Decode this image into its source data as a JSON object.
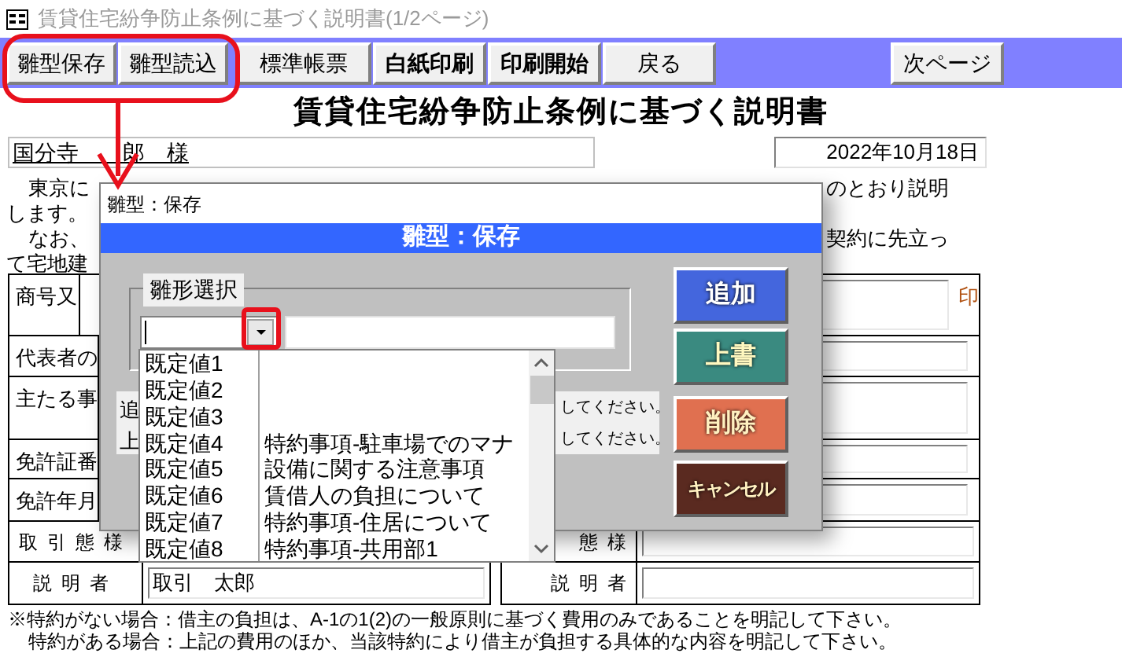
{
  "window": {
    "title": "賃貸住宅紛争防止条例に基づく説明書(1/2ページ)"
  },
  "toolbar": {
    "buttons": [
      {
        "label": "雛型保存",
        "bold": false
      },
      {
        "label": "雛型読込",
        "bold": false
      },
      {
        "label": "標準帳票",
        "bold": false
      },
      {
        "label": "白紙印刷",
        "bold": true
      },
      {
        "label": "印刷開始",
        "bold": true
      },
      {
        "label": "戻る",
        "bold": false
      },
      {
        "label": "次ページ",
        "bold": false
      }
    ]
  },
  "heading": "賃貸住宅紛争防止条例に基づく説明書",
  "addressee": "国分寺　　郎　様",
  "date": "2022年10月18日",
  "intro": {
    "left": [
      "東京に",
      "します。",
      "なお、",
      "て宅地建"
    ],
    "right": [
      "のとおり説明",
      "契約に先立っ"
    ]
  },
  "form_rows": [
    {
      "label": "商号又",
      "seal": "印"
    },
    {
      "label": "代表者の"
    },
    {
      "label": "主たる事"
    },
    {
      "label": "免許証番"
    },
    {
      "label": "免許年月"
    }
  ],
  "lower_rows": [
    {
      "label_left": "取引態様",
      "value_left": "",
      "label_right": "態様",
      "value_right": ""
    },
    {
      "label_left": "説明者",
      "value_left": "取引　太郎",
      "label_right": "説明者",
      "value_right": ""
    }
  ],
  "footnotes": [
    "※特約がない場合：借主の負担は、A-1の1(2)の一般原則に基づく費用のみであることを明記して下さい。",
    "特約がある場合：上記の費用のほか、当該特約により借主が負担する具体的な内容を明記して下さい。"
  ],
  "dialog": {
    "title": "雛型：保存",
    "header": "雛型：保存",
    "group_label": "雛形選択",
    "hints": [
      {
        "start": "追",
        "end": "してください。"
      },
      {
        "start": "上",
        "end": "してください。"
      }
    ],
    "buttons": [
      {
        "label": "追加",
        "kind": "add"
      },
      {
        "label": "上書",
        "kind": "overwrite"
      },
      {
        "label": "削除",
        "kind": "delete"
      },
      {
        "label": "キャンセル",
        "kind": "cancel"
      }
    ],
    "list": [
      {
        "value": "既定値1"
      },
      {
        "value": "既定値2"
      },
      {
        "value": "既定値3"
      },
      {
        "value": "既定値4",
        "description": "特約事項-駐車場でのマナ"
      },
      {
        "value": "既定値5",
        "description": "設備に関する注意事項"
      },
      {
        "value": "既定値6",
        "description": "賃借人の負担について"
      },
      {
        "value": "既定値7",
        "description": "特約事項-住居について"
      },
      {
        "value": "既定値8",
        "description": "特約事項-共用部1"
      }
    ]
  },
  "annotations": [
    {
      "kind": "rounded-outline"
    },
    {
      "kind": "arrow"
    },
    {
      "kind": "square-outline"
    }
  ]
}
